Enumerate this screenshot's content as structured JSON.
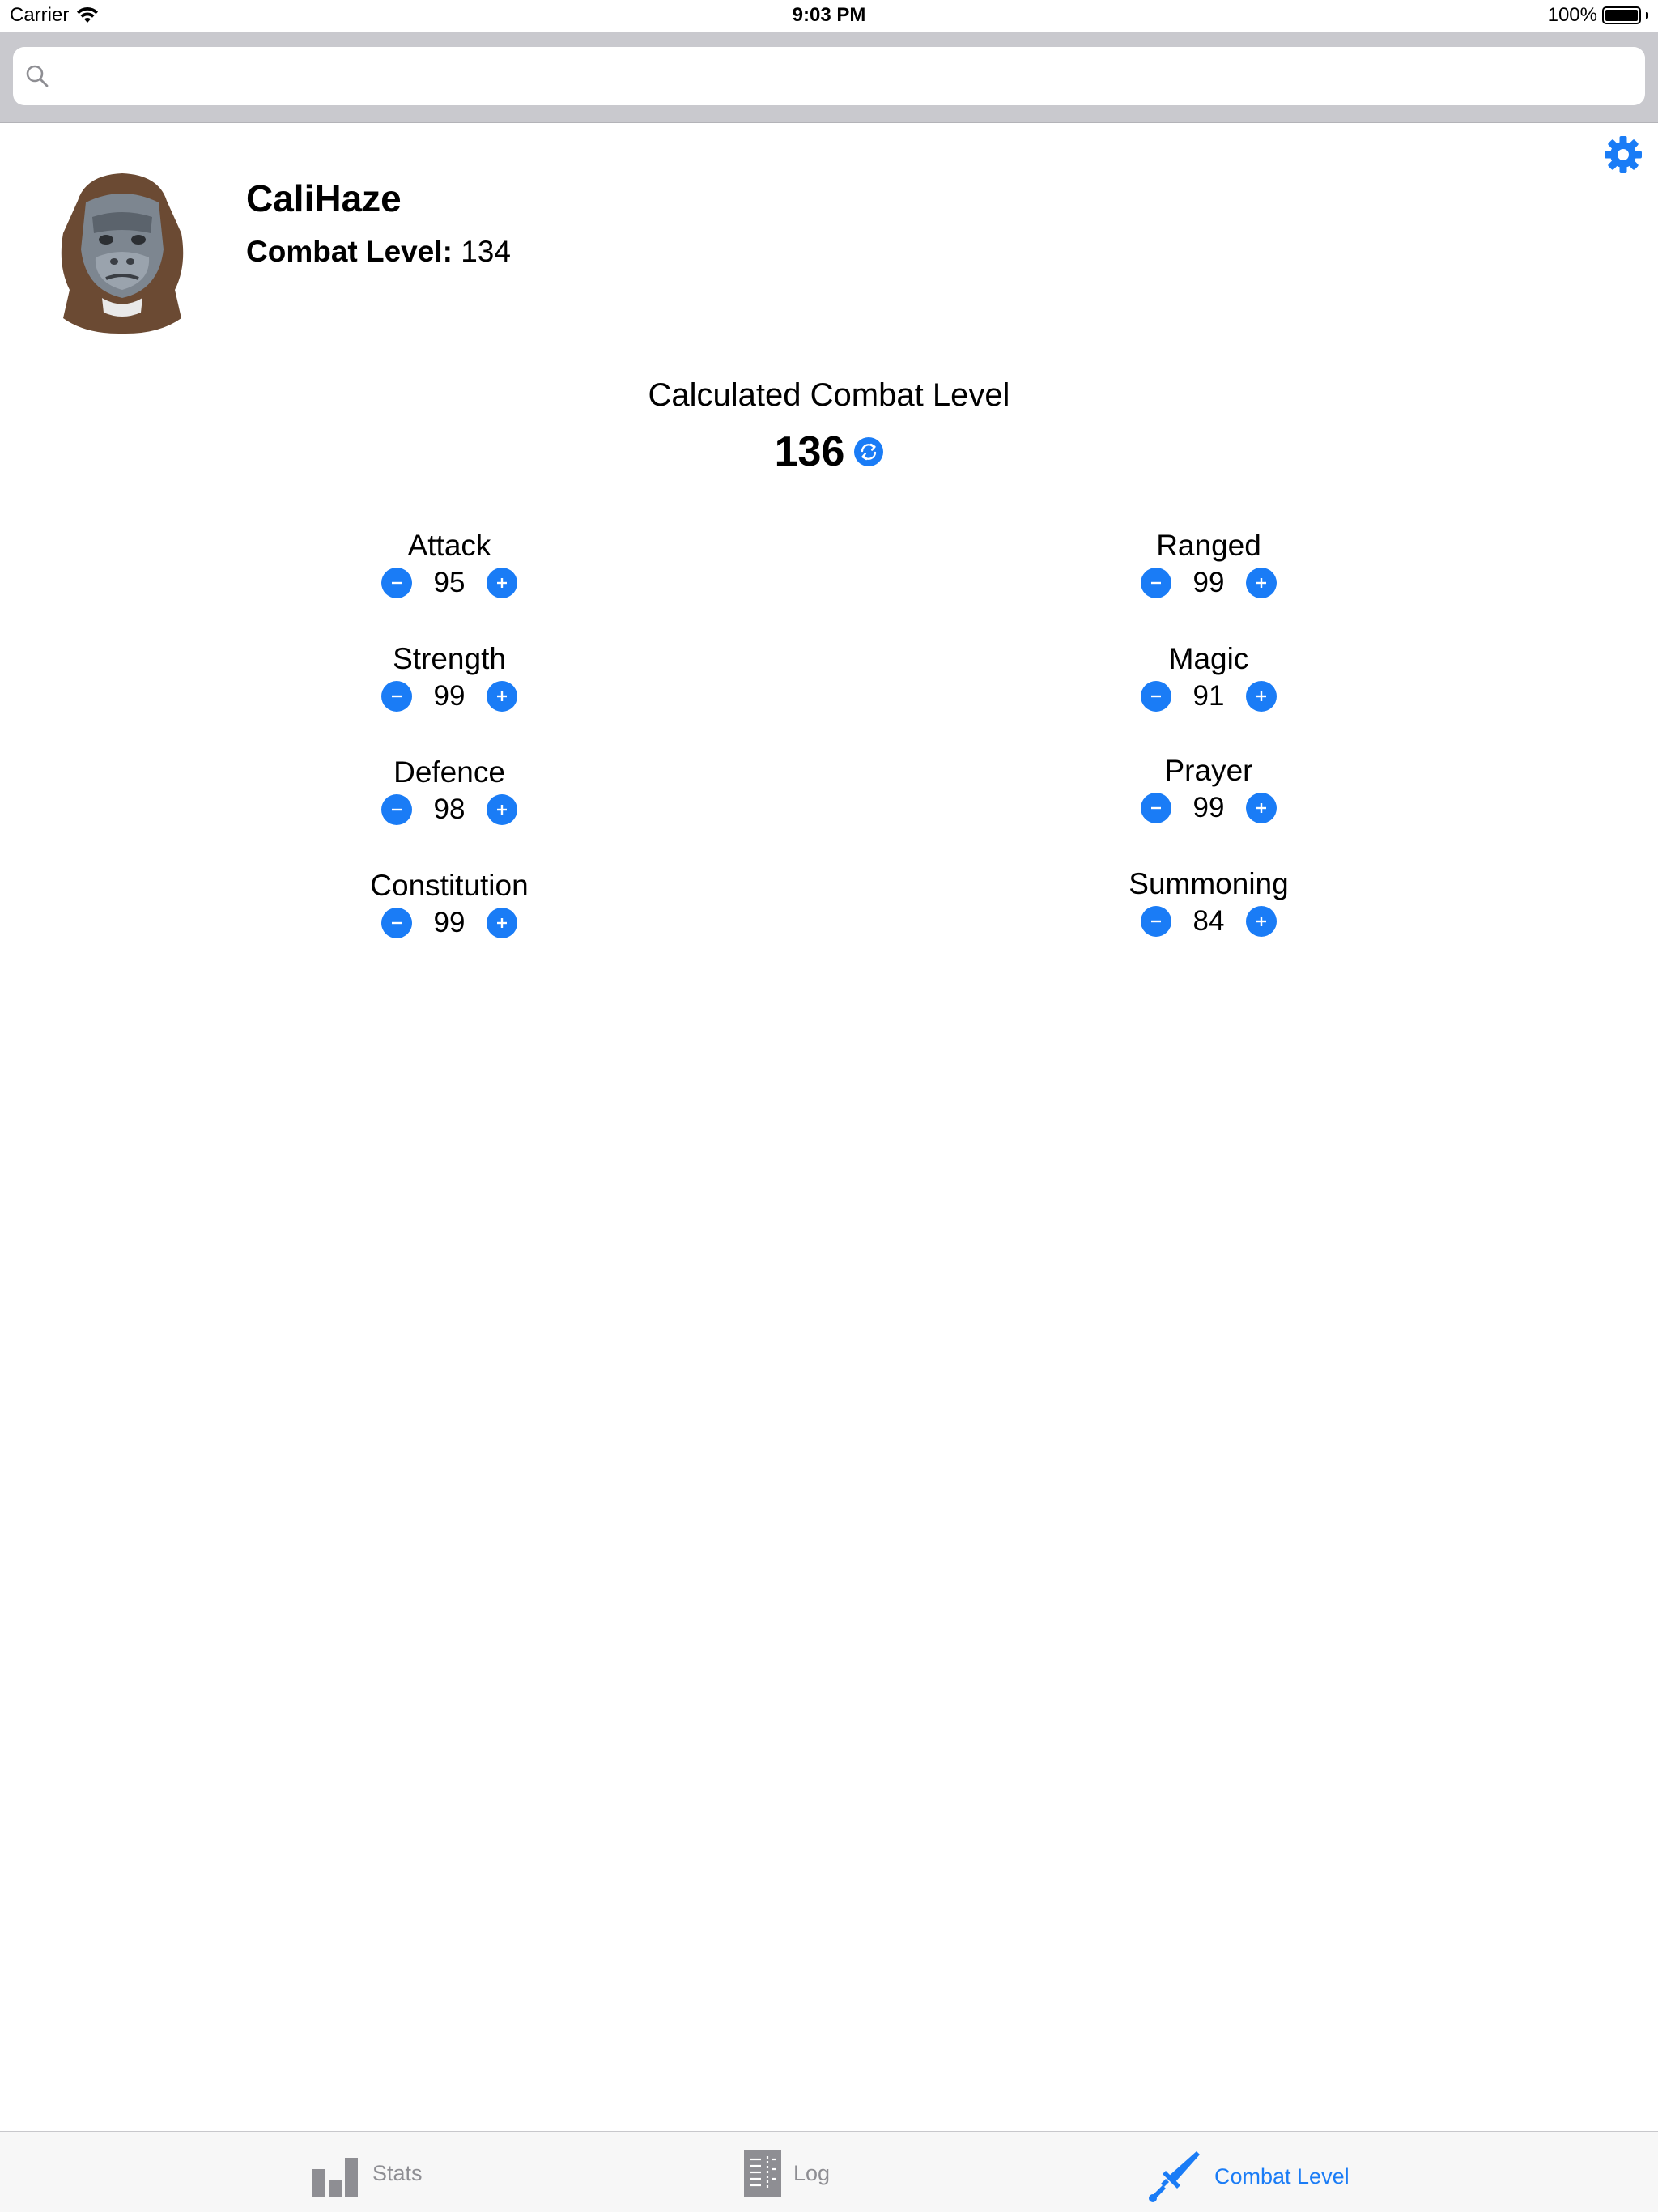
{
  "status_bar": {
    "carrier": "Carrier",
    "time": "9:03 PM",
    "battery": "100%"
  },
  "search": {
    "placeholder": "",
    "value": ""
  },
  "profile": {
    "name": "CaliHaze",
    "combat_label": "Combat Level:",
    "combat_value": "134"
  },
  "calculated": {
    "title": "Calculated Combat Level",
    "value": "136"
  },
  "skills": {
    "attack": {
      "label": "Attack",
      "value": "95"
    },
    "strength": {
      "label": "Strength",
      "value": "99"
    },
    "defence": {
      "label": "Defence",
      "value": "98"
    },
    "constitution": {
      "label": "Constitution",
      "value": "99"
    },
    "ranged": {
      "label": "Ranged",
      "value": "99"
    },
    "magic": {
      "label": "Magic",
      "value": "91"
    },
    "prayer": {
      "label": "Prayer",
      "value": "99"
    },
    "summoning": {
      "label": "Summoning",
      "value": "84"
    }
  },
  "tabs": [
    {
      "label": "Stats",
      "icon": "bar-chart-icon",
      "active": false
    },
    {
      "label": "Log",
      "icon": "log-icon",
      "active": false
    },
    {
      "label": "Combat Level",
      "icon": "sword-icon",
      "active": true
    }
  ],
  "colors": {
    "accent": "#1a7cf6",
    "inactive_tab": "#8e8e93",
    "search_bg": "#c9c9ce"
  }
}
